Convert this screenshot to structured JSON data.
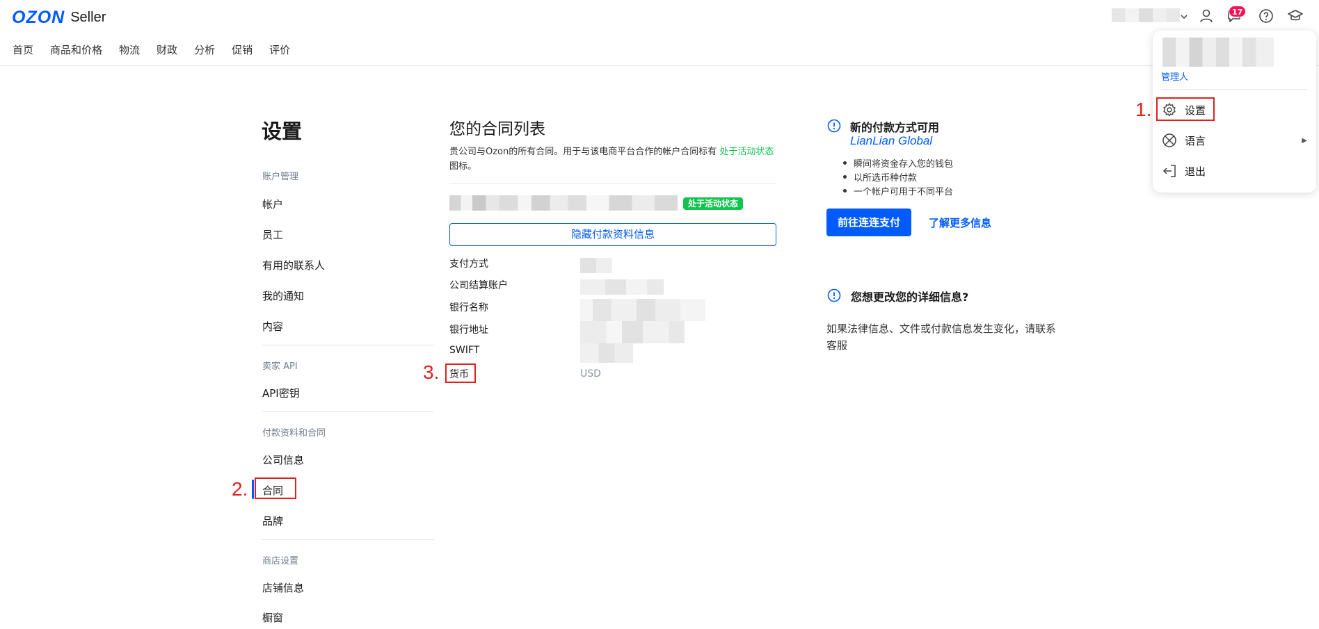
{
  "brand": {
    "logo": "OZON",
    "product": "Seller"
  },
  "top_nav": [
    "首页",
    "商品和价格",
    "物流",
    "财政",
    "分析",
    "促销",
    "评价"
  ],
  "header": {
    "notification_count": "17"
  },
  "dropdown": {
    "role": "管理人",
    "items": [
      {
        "label": "设置",
        "icon": "gear-icon"
      },
      {
        "label": "语言",
        "icon": "globe-icon"
      },
      {
        "label": "退出",
        "icon": "logout-icon"
      }
    ]
  },
  "settings": {
    "title": "设置",
    "sections": [
      {
        "heading": "账户管理",
        "items": [
          "帐户",
          "员工",
          "有用的联系人",
          "我的通知",
          "内容"
        ]
      },
      {
        "heading": "卖家 API",
        "items": [
          "API密钥"
        ]
      },
      {
        "heading": "付款资料和合同",
        "items": [
          "公司信息",
          "合同",
          "品牌"
        ]
      },
      {
        "heading": "商店设置",
        "items": [
          "店铺信息",
          "橱窗"
        ]
      }
    ]
  },
  "contracts": {
    "title": "您的合同列表",
    "description_pre": "贵公司与Ozon的所有合同。用于与该电商平台合作的帐户合同标有",
    "description_highlight": "处于活动状态",
    "description_post": "图标。",
    "active_badge": "处于活动状态",
    "hide_button": "隐藏付款资料信息",
    "fields": [
      {
        "label": "支付方式",
        "value": ""
      },
      {
        "label": "公司结算账户",
        "value": ""
      },
      {
        "label": "银行名称",
        "value": ""
      },
      {
        "label": "银行地址",
        "value": ""
      },
      {
        "label": "SWIFT",
        "value": ""
      },
      {
        "label": "货币",
        "value": "USD"
      }
    ]
  },
  "payment_promo": {
    "title": "新的付款方式可用",
    "provider": "LianLian Global",
    "bullets": [
      "瞬间将资金存入您的钱包",
      "以所选币种付款",
      "一个帐户可用于不同平台"
    ],
    "button": "前往连连支付",
    "link": "了解更多信息"
  },
  "change_info": {
    "title": "您想更改您的详细信息?",
    "description": "如果法律信息、文件或付款信息发生变化，请联系客服"
  },
  "annotations": [
    "1.",
    "2.",
    "3."
  ],
  "colors": {
    "brand_blue": "#005bff",
    "active_green": "#10c44c",
    "annotation_red": "#e0201c",
    "badge_pink": "#f91155"
  }
}
